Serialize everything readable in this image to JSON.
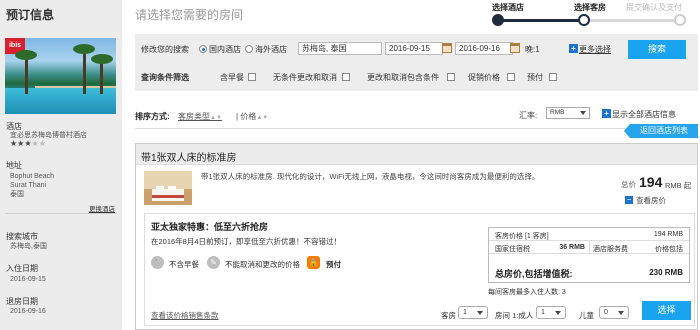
{
  "sidebar": {
    "title": "预订信息",
    "brand": "ibis",
    "hotel_label": "酒店",
    "hotel_name": "宜必思苏梅岛博普村酒店",
    "stars": 3,
    "stars_max": 5,
    "address_label": "地址",
    "address_lines": [
      "Bophut Beach",
      "Surat Thani",
      "泰国"
    ],
    "change_hotel": "更换酒店",
    "city_label": "搜索城市",
    "city_value": "苏梅岛,泰国",
    "checkin_label": "入住日期",
    "checkin_value": "2016-09-15",
    "checkout_label": "退房日期",
    "checkout_value": "2016-09-16"
  },
  "header": {
    "page_title": "请选择您需要的房间",
    "steps": [
      {
        "label": "选择酒店",
        "state": "done"
      },
      {
        "label": "选择客房",
        "state": "current"
      },
      {
        "label": "提交确认及支付",
        "state": "todo"
      }
    ]
  },
  "search": {
    "label": "修改您的搜索",
    "radio_domestic": "国内酒店",
    "radio_overseas": "海外酒店",
    "destination": "苏梅岛, 泰国",
    "checkin": "2016-09-15",
    "checkout": "2016-09-16",
    "nights_label": "晚:",
    "nights": "1",
    "more_options": "更多选择",
    "search_button": "搜索",
    "filter_label": "查询条件筛选",
    "filters": [
      "含早餐",
      "无条件更改和取消",
      "更改和取消包含条件",
      "促销价格",
      "预付"
    ]
  },
  "sort": {
    "label": "排序方式:",
    "room_type": "客房类型",
    "price": "价格",
    "rate_label": "汇率:",
    "currency": "RMB",
    "show_all": "显示全部酒店信息",
    "back_button": "返回酒店列表"
  },
  "room": {
    "title": "带1张双人床的标准房",
    "description": "带1张双人床的标准房. 现代化的设计，WiFi无线上网，液晶电视，令这间时尚客房成为最便利的选择。",
    "price_prefix": "总价",
    "price": "194",
    "price_unit": "RMB 起",
    "view_more": "查看房价",
    "offer": {
      "title": "亚太独家特惠：低至六折抢房",
      "subtitle": "在2016年8月4日前预订，即享低至六折优惠！不容错过！",
      "features": [
        {
          "icon": "fork-knife-icon",
          "glyph": "🍴",
          "label": "不含早餐"
        },
        {
          "icon": "no-change-icon",
          "glyph": "✎",
          "label": "不能取消和更改的价格"
        },
        {
          "icon": "lock-icon",
          "glyph": "🔒",
          "label": "预付"
        }
      ],
      "terms_link": "查看该价格销售条款",
      "price_rows": {
        "room_price_label": "客房价格 [1 客房]",
        "room_price_value": "194 RMB",
        "tax_label": "国家住宿税",
        "tax_value": "36 RMB",
        "service_label": "酒店服务费",
        "service_value": "价格包括",
        "total_label": "总房价,包括增值税:",
        "total_value": "230 RMB"
      },
      "max_guests": "每间客房最多入住人数: 3",
      "rooms_label": "客房",
      "rooms_value": "1",
      "room1_label": "房间 1:成人",
      "adults_value": "1",
      "children_label": "儿童",
      "children_value": "0",
      "choose_button": "选择"
    }
  },
  "colors": {
    "accent": "#1aa3ef",
    "progress": "#1e2c3e",
    "lock": "#f57c00"
  }
}
